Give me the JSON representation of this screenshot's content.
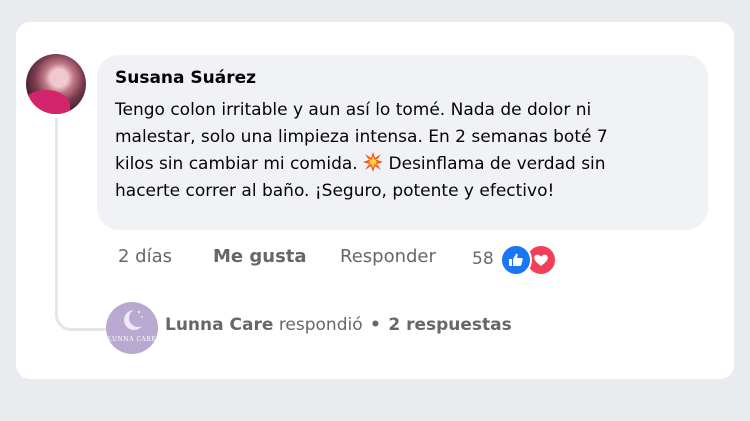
{
  "comment": {
    "author": "Susana Suárez",
    "text_lines": [
      "Tengo colon irritable y aun así lo tomé. Nada de dolor ni",
      "malestar, solo una limpieza intensa. En 2 semanas boté 7",
      "kilos sin cambiar mi comida.",
      "hacerte correr al baño. ¡Seguro, potente y efectivo!"
    ],
    "line3_after_icon": "Desinflama de verdad sin",
    "time": "2 días",
    "like_label": "Me gusta",
    "reply_label": "Responder",
    "reaction_count": "58",
    "reactions": [
      "like-icon",
      "love-icon"
    ]
  },
  "reply_summary": {
    "name": "Lunna Care",
    "verb": "respondió",
    "separator": "•",
    "count_label": "2 respuestas",
    "avatar_brand": "LUNNA CARE"
  },
  "colors": {
    "like_blue": "#1877f2",
    "love_red": "#f33e58",
    "bubble_bg": "#f0f2f5",
    "muted_text": "#65676b"
  }
}
